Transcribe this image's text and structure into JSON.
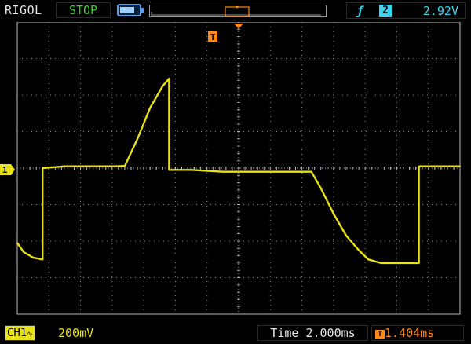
{
  "header": {
    "brand": "RIGOL",
    "run_state": "STOP",
    "battery_level": 0.8,
    "trigger": {
      "edge_icon": "rising-edge-icon",
      "source": "2",
      "level": "2.92V"
    },
    "trigger_position_marker": "T"
  },
  "screen": {
    "trigger_marker_label": "T",
    "channel_marker_label": "1",
    "grid": "dotted"
  },
  "footer": {
    "channel": {
      "label": "CH1",
      "coupling_icon": "ac-coupling-icon"
    },
    "volts_div": "200mV",
    "timebase": "Time 2.000ms",
    "trigger_offset_icon": "trigger-offset-icon",
    "trigger_offset": "1.404ms"
  },
  "colors": {
    "trace": "#e8e216",
    "trigger": "#ff8a1a",
    "trigger_info": "#37d6ee",
    "stop": "#35d92e",
    "grid_dot": "#8a8a8a"
  },
  "chart_data": {
    "type": "line",
    "title": "",
    "xlabel": "",
    "ylabel": "",
    "x_divisions": 14,
    "y_divisions": 8,
    "units": "divisions relative to screen center",
    "xlim": [
      -7,
      7
    ],
    "ylim": [
      -4,
      4
    ],
    "series": [
      {
        "x": [
          -7.0,
          -6.8,
          -6.5,
          -6.2,
          -6.2,
          -5.5,
          -5.0,
          -4.4,
          -3.9,
          -3.6,
          -3.2,
          -2.8,
          -2.4,
          -2.2,
          -2.2,
          -1.5,
          -0.5,
          0.5,
          1.6,
          2.3,
          2.6,
          3.0,
          3.4,
          3.8,
          4.1,
          4.5,
          5.0,
          5.3,
          5.7,
          5.7,
          6.3,
          7.0
        ],
        "y": [
          -2.05,
          -2.3,
          -2.45,
          -2.5,
          0.0,
          0.05,
          0.05,
          0.05,
          0.05,
          0.06,
          0.8,
          1.65,
          2.25,
          2.45,
          -0.05,
          -0.05,
          -0.1,
          -0.1,
          -0.1,
          -0.1,
          -0.55,
          -1.25,
          -1.85,
          -2.25,
          -2.5,
          -2.6,
          -2.6,
          -2.6,
          -2.6,
          0.05,
          0.05,
          0.05
        ]
      }
    ]
  }
}
